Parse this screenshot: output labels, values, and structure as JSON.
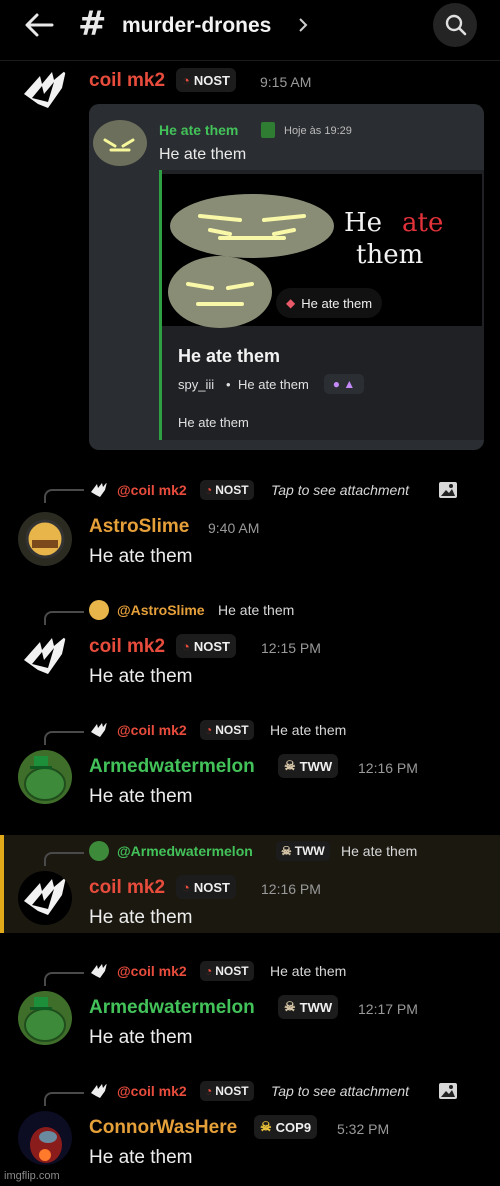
{
  "header": {
    "channel": "murder-drones"
  },
  "embed": {
    "inner_name": "He ate them",
    "inner_time": "Hoje às 19:29",
    "inner_text": "He ate them",
    "image_caption_word1": "He",
    "image_caption_word2": "ate",
    "image_caption_word3": "them",
    "pill_label": "He ate them",
    "title": "He ate them",
    "sub_user": "spy_iii",
    "sub_sep": "•",
    "sub_text": "He ate them",
    "footer": "He ate them"
  },
  "messages": [
    {
      "name": "coil mk2",
      "badge": "NOST",
      "time": "9:15 AM"
    },
    {
      "reply_name": "@coil mk2",
      "reply_badge": "NOST",
      "reply_text": "Tap to see attachment",
      "name": "AstroSlime",
      "time": "9:40 AM",
      "text": "He ate them"
    },
    {
      "reply_name": "@AstroSlime",
      "reply_text": "He ate them",
      "name": "coil mk2",
      "badge": "NOST",
      "time": "12:15 PM",
      "text": "He ate them"
    },
    {
      "reply_name": "@coil mk2",
      "reply_badge": "NOST",
      "reply_text": "He ate them",
      "name": "Armedwatermelon",
      "badge": "TWW",
      "time": "12:16 PM",
      "text": "He ate them"
    },
    {
      "reply_name": "@Armedwatermelon",
      "reply_badge": "TWW",
      "reply_text": "He ate them",
      "name": "coil mk2",
      "badge": "NOST",
      "time": "12:16 PM",
      "text": "He ate them"
    },
    {
      "reply_name": "@coil mk2",
      "reply_badge": "NOST",
      "reply_text": "He ate them",
      "name": "Armedwatermelon",
      "badge": "TWW",
      "time": "12:17 PM",
      "text": "He ate them"
    },
    {
      "reply_name": "@coil mk2",
      "reply_badge": "NOST",
      "reply_text": "Tap to see attachment",
      "name": "ConnorWasHere",
      "badge": "COP9",
      "time": "5:32 PM",
      "text": "He ate them"
    }
  ],
  "watermark": "imgflip.com",
  "colors": {
    "coil": "#e74c3c",
    "astro": "#e6a03a",
    "melon": "#43c25a",
    "connor": "#e6a03a",
    "highlight": "#e0a91a"
  }
}
